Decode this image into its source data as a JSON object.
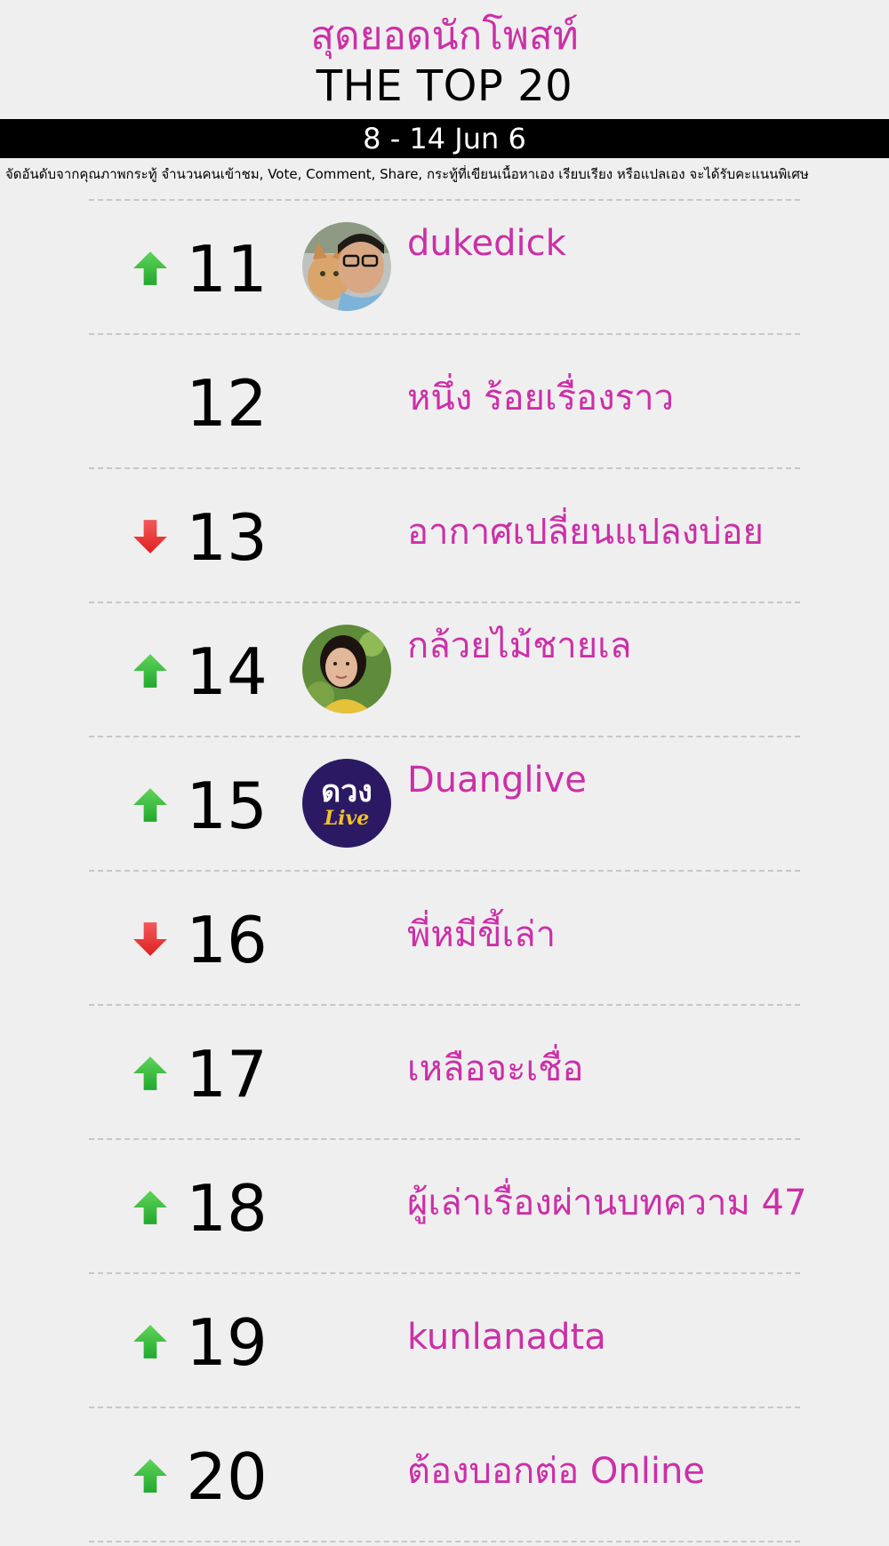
{
  "header": {
    "title_thai": "สุดยอดนักโพสท์",
    "title": "THE TOP 20",
    "date_range": "8 - 14 Jun 6",
    "note": "จัดอันดับจากคุณภาพกระทู้ จำนวนคนเข้าชม, Vote, Comment, Share, กระทู้ที่เขียนเนื้อหาเอง เรียบเรียง หรือแปลเอง จะได้รับคะแนนพิเศษ"
  },
  "colors": {
    "accent": "#cc2fa8",
    "up": "#22a82d",
    "down": "#e02020",
    "date_bar": "#000000"
  },
  "rows": [
    {
      "rank": "11",
      "trend": "up",
      "name": "dukedick",
      "avatar": "person-with-cat-photo"
    },
    {
      "rank": "12",
      "trend": "none",
      "name": "หนึ่ง ร้อยเรื่องราว",
      "avatar": ""
    },
    {
      "rank": "13",
      "trend": "down",
      "name": "อากาศเปลี่ยนแปลงบ่อย",
      "avatar": ""
    },
    {
      "rank": "14",
      "trend": "up",
      "name": "กล้วยไม้ชายเล",
      "avatar": "woman-portrait-photo"
    },
    {
      "rank": "15",
      "trend": "up",
      "name": "Duanglive",
      "avatar": "duanglive-logo",
      "logo_text": "ดวง",
      "logo_sub": "Live"
    },
    {
      "rank": "16",
      "trend": "down",
      "name": "พี่หมีขี้เล่า",
      "avatar": ""
    },
    {
      "rank": "17",
      "trend": "up",
      "name": "เหลือจะเชื่อ",
      "avatar": ""
    },
    {
      "rank": "18",
      "trend": "up",
      "name": "ผู้เล่าเรื่องผ่านบทความ 47",
      "avatar": ""
    },
    {
      "rank": "19",
      "trend": "up",
      "name": "kunlanadta",
      "avatar": ""
    },
    {
      "rank": "20",
      "trend": "up",
      "name": "ต้องบอกต่อ Online",
      "avatar": ""
    }
  ]
}
